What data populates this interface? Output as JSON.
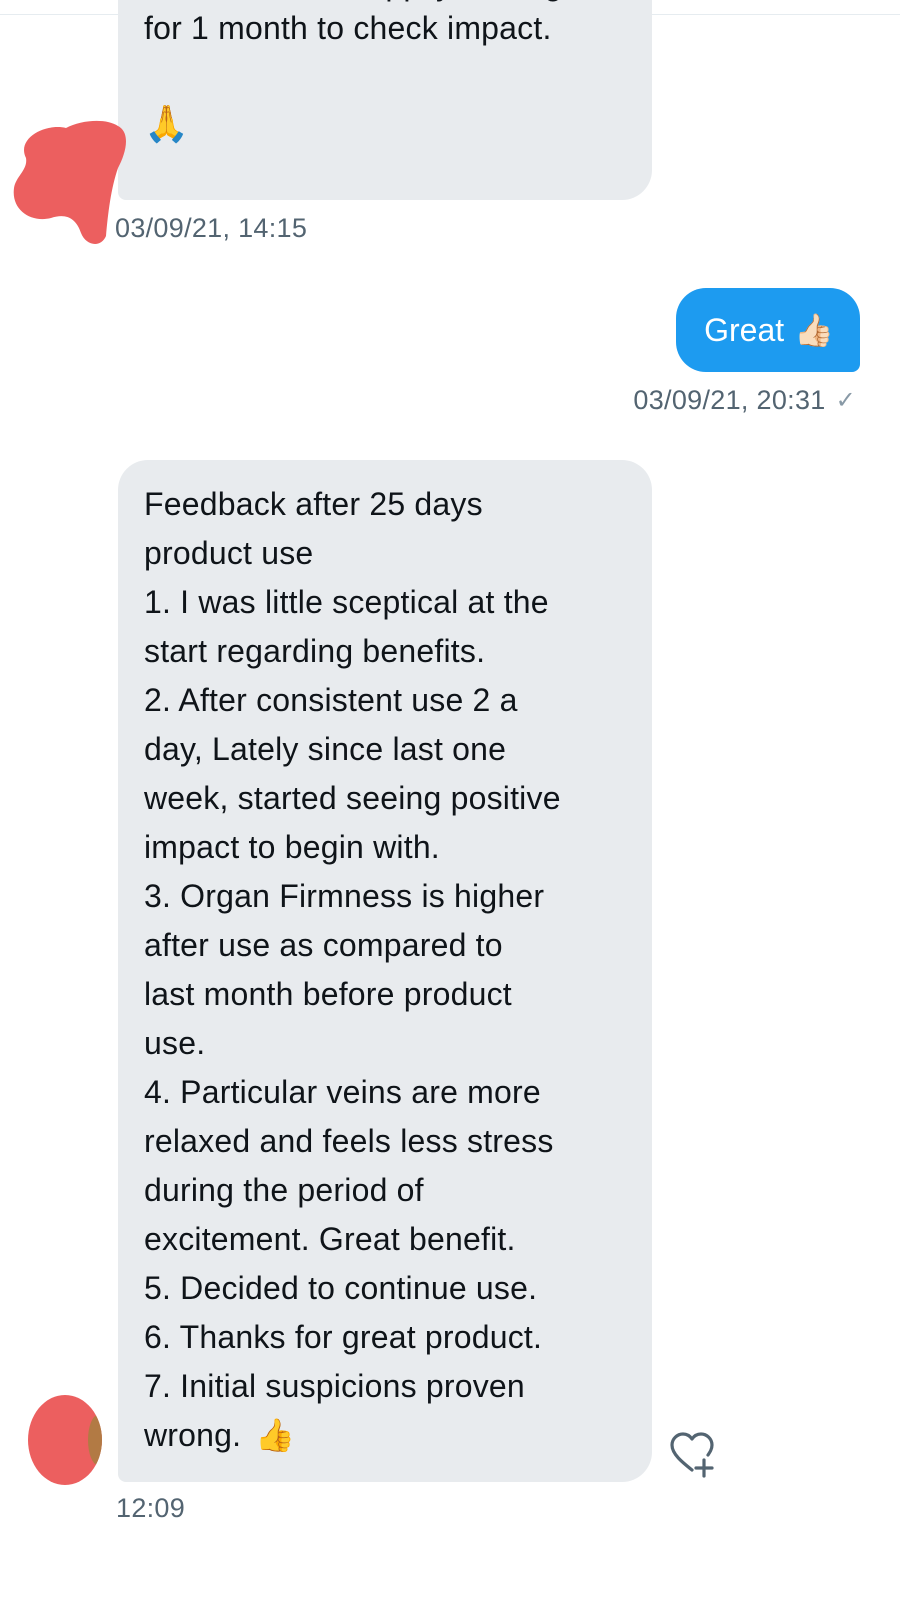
{
  "conversation": {
    "messages": [
      {
        "direction": "incoming",
        "clipped_top_line": "Thanks. Now, happily waiting",
        "text": "for 1 month to check impact.",
        "emoji": "🙏",
        "timestamp": "03/09/21, 14:15"
      },
      {
        "direction": "outgoing",
        "text": "Great",
        "emoji": "👍🏻",
        "timestamp": "03/09/21, 20:31",
        "status_icon": "check-icon"
      },
      {
        "direction": "incoming",
        "lines": [
          "Feedback after 25 days",
          "product use",
          "1. I was little sceptical at the",
          "start regarding benefits.",
          "2. After consistent use 2 a",
          "day, Lately since last one",
          "week, started seeing positive",
          "impact to begin with.",
          "3. Organ Firmness is  higher",
          "after use as compared to",
          "last month before product",
          "use.",
          "4. Particular veins are more",
          "relaxed and feels less stress",
          "during the period of",
          "excitement. Great benefit.",
          "5. Decided to continue use.",
          "6. Thanks for great product.",
          "7. Initial suspicions proven",
          "wrong."
        ],
        "emoji": "👍",
        "timestamp": "12:09",
        "reaction_icon": "heart-plus-icon"
      }
    ]
  },
  "colors": {
    "incoming_bubble": "#e8ebee",
    "outgoing_bubble": "#1d9bf0",
    "timestamp_text": "#536471",
    "redaction": "#ec5f5f"
  }
}
